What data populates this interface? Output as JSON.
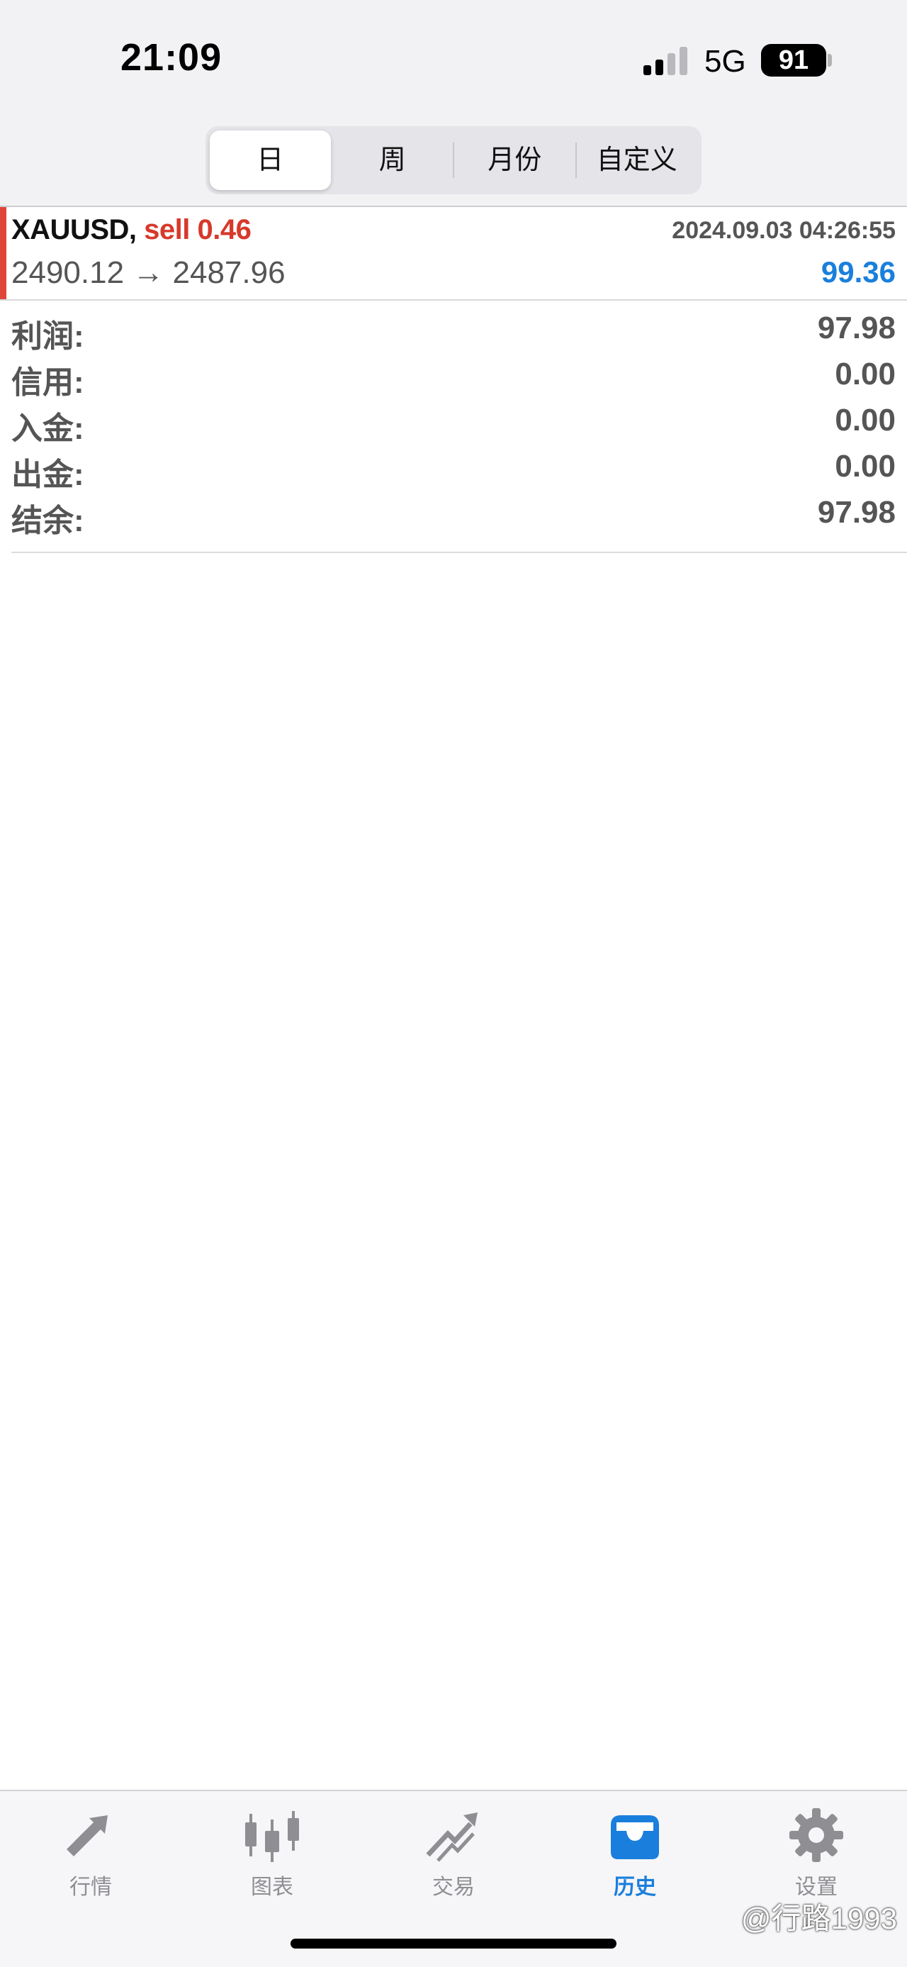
{
  "status_bar": {
    "time": "21:09",
    "network": "5G",
    "battery": "91",
    "icons": [
      "signal-bars-icon",
      "battery-icon"
    ]
  },
  "segments": {
    "items": [
      {
        "label": "日",
        "active": true
      },
      {
        "label": "周",
        "active": false
      },
      {
        "label": "月份",
        "active": false
      },
      {
        "label": "自定义",
        "active": false
      }
    ]
  },
  "trade": {
    "symbol": "XAUUSD,",
    "side": "sell 0.46",
    "datetime": "2024.09.03 04:26:55",
    "prices": "2490.12 → 2487.96",
    "profit": "99.36",
    "side_color": "#d6392b",
    "profit_color": "#1a7fdc",
    "accent_color": "#e0453a"
  },
  "summary": {
    "rows": [
      {
        "label": "利润:",
        "value": "97.98"
      },
      {
        "label": "信用:",
        "value": "0.00"
      },
      {
        "label": "入金:",
        "value": "0.00"
      },
      {
        "label": "出金:",
        "value": "0.00"
      },
      {
        "label": "结余:",
        "value": "97.98"
      }
    ]
  },
  "tab_bar": {
    "tabs": [
      {
        "label": "行情",
        "icon": "quotes-arrows-icon",
        "active": false
      },
      {
        "label": "图表",
        "icon": "candlestick-chart-icon",
        "active": false
      },
      {
        "label": "交易",
        "icon": "trade-trend-icon",
        "active": false
      },
      {
        "label": "历史",
        "icon": "history-inbox-icon",
        "active": true
      },
      {
        "label": "设置",
        "icon": "gear-icon",
        "active": false
      }
    ],
    "active_color": "#1a7fdc",
    "inactive_color": "#8e8e93"
  },
  "watermark": "@行路1993"
}
